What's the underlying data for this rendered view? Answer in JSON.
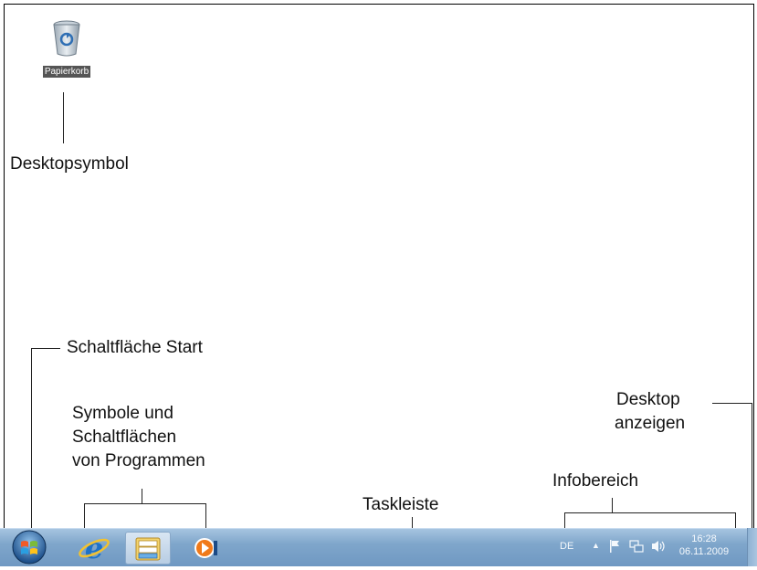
{
  "desktop": {
    "icon_label": "Papierkorb"
  },
  "annotations": {
    "desktop_symbol": "Desktopsymbol",
    "start_button": "Schaltfläche Start",
    "program_buttons_line1": "Symbole und",
    "program_buttons_line2": "Schaltflächen",
    "program_buttons_line3": "von Programmen",
    "taskbar": "Taskleiste",
    "info_area": "Infobereich",
    "show_desktop_line1": "Desktop",
    "show_desktop_line2": "anzeigen"
  },
  "tray": {
    "language": "DE",
    "time": "16:28",
    "date": "06.11.2009"
  },
  "icons": {
    "start": "windows-orb-icon",
    "browser": "internet-explorer-icon",
    "explorer": "folder-library-icon",
    "media": "media-player-icon",
    "arrow": "show-hidden-icons-arrow",
    "flag": "action-center-flag-icon",
    "network": "network-icon",
    "volume": "speaker-volume-icon"
  }
}
